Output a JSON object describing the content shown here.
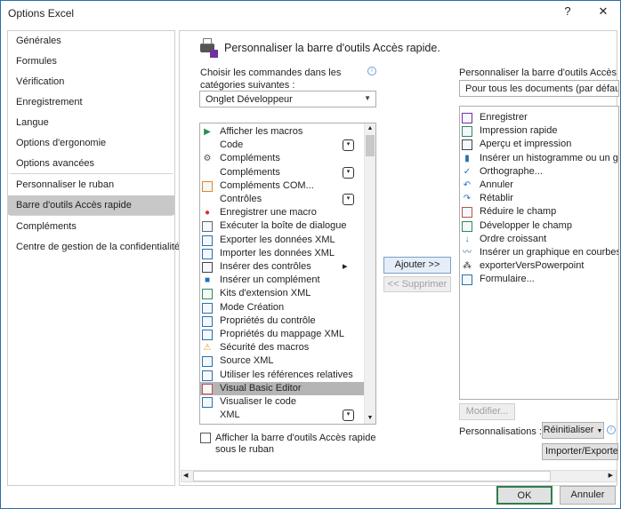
{
  "window": {
    "title": "Options Excel",
    "help": "?",
    "close": "✕"
  },
  "sidebar": {
    "items": [
      {
        "label": "Générales"
      },
      {
        "label": "Formules"
      },
      {
        "label": "Vérification"
      },
      {
        "label": "Enregistrement"
      },
      {
        "label": "Langue"
      },
      {
        "label": "Options d'ergonomie"
      },
      {
        "label": "Options avancées"
      },
      {
        "label": "Personnaliser le ruban"
      },
      {
        "label": "Barre d'outils Accès rapide",
        "selected": true
      },
      {
        "label": "Compléments"
      },
      {
        "label": "Centre de gestion de la confidentialité"
      }
    ]
  },
  "main": {
    "heading": "Personnaliser la barre d'outils Accès rapide.",
    "choose_label_1": "Choisir les commandes dans les",
    "choose_label_2": "catégories suivantes :",
    "category_value": "Onglet Développeur",
    "commands": [
      {
        "label": "Afficher les macros",
        "icon": "play-icon",
        "color": "#2e8b57"
      },
      {
        "label": "Code",
        "icon": "",
        "sub": true
      },
      {
        "label": "Compléments",
        "icon": "gears-icon",
        "color": "#555"
      },
      {
        "label": "Compléments",
        "icon": "",
        "sub": true
      },
      {
        "label": "Compléments COM...",
        "icon": "com-addin-icon",
        "color": "#d98b1e"
      },
      {
        "label": "Contrôles",
        "icon": "",
        "sub": true
      },
      {
        "label": "Enregistrer une macro",
        "icon": "record-macro-icon",
        "color": "#d9322b"
      },
      {
        "label": "Exécuter la boîte de dialogue",
        "icon": "dialog-icon",
        "color": "#666"
      },
      {
        "label": "Exporter les données XML",
        "icon": "export-xml-icon",
        "color": "#2b6fa8"
      },
      {
        "label": "Importer les données XML",
        "icon": "import-xml-icon",
        "color": "#2b6fa8"
      },
      {
        "label": "Insérer des contrôles",
        "icon": "controls-icon",
        "color": "#444",
        "arrow": true
      },
      {
        "label": "Insérer un complément",
        "icon": "addin-icon",
        "color": "#1f6fc5"
      },
      {
        "label": "Kits d'extension XML",
        "icon": "xml-kit-icon",
        "color": "#2e8b57"
      },
      {
        "label": "Mode Création",
        "icon": "design-mode-icon",
        "color": "#2b6fa8"
      },
      {
        "label": "Propriétés du contrôle",
        "icon": "properties-icon",
        "color": "#2b6fa8"
      },
      {
        "label": "Propriétés du mappage XML",
        "icon": "xml-map-icon",
        "color": "#2b6fa8"
      },
      {
        "label": "Sécurité des macros",
        "icon": "warning-icon",
        "color": "#e0a020"
      },
      {
        "label": "Source XML",
        "icon": "xml-source-icon",
        "color": "#2b6fa8"
      },
      {
        "label": "Utiliser les références relatives",
        "icon": "relative-ref-icon",
        "color": "#2b6fa8"
      },
      {
        "label": "Visual Basic Editor",
        "icon": "vba-icon",
        "color": "#c0504d",
        "selected": true
      },
      {
        "label": "Visualiser le code",
        "icon": "view-code-icon",
        "color": "#2b6fa8"
      },
      {
        "label": "XML",
        "icon": "",
        "sub": true
      }
    ],
    "show_below_ribbon_1": "Afficher la barre d'outils Accès rapide",
    "show_below_ribbon_2": "sous le ruban",
    "show_below_ribbon_checked": false,
    "add_button": "Ajouter >>",
    "remove_button": "<< Supprimer",
    "customize_label": "Personnaliser la barre d'outils Accès rapide :",
    "scope_value": "Pour tous les documents (par défaut)",
    "toolbar_items": [
      {
        "label": "Enregistrer",
        "icon": "save-icon",
        "color": "#7030a0"
      },
      {
        "label": "Impression rapide",
        "icon": "quick-print-icon",
        "color": "#2e8b57"
      },
      {
        "label": "Aperçu et impression",
        "icon": "print-preview-icon",
        "color": "#444"
      },
      {
        "label": "Insérer un histogramme ou un graphique à barres",
        "icon": "bar-chart-icon",
        "color": "#2b6fa8"
      },
      {
        "label": "Orthographe...",
        "icon": "spelling-icon",
        "color": "#2b6fa8"
      },
      {
        "label": "Annuler",
        "icon": "undo-icon",
        "color": "#1f6fc5"
      },
      {
        "label": "Rétablir",
        "icon": "redo-icon",
        "color": "#1f6fc5"
      },
      {
        "label": "Réduire le champ",
        "icon": "collapse-field-icon",
        "color": "#c0504d"
      },
      {
        "label": "Développer le champ",
        "icon": "expand-field-icon",
        "color": "#2e8b57"
      },
      {
        "label": "Ordre croissant",
        "icon": "sort-asc-icon",
        "color": "#2b6fa8"
      },
      {
        "label": "Insérer un graphique en courbes ou en aires",
        "icon": "line-chart-icon",
        "color": "#2b6fa8"
      },
      {
        "label": "exporterVersPowerpoint",
        "icon": "org-chart-icon",
        "color": "#333"
      },
      {
        "label": "Formulaire...",
        "icon": "form-icon",
        "color": "#2b6fa8"
      }
    ],
    "modify_button": "Modifier...",
    "customizations_label": "Personnalisations :",
    "reset_button": "Réinitialiser",
    "import_export_button": "Importer/Exporter"
  },
  "footer": {
    "ok": "OK",
    "cancel": "Annuler"
  }
}
